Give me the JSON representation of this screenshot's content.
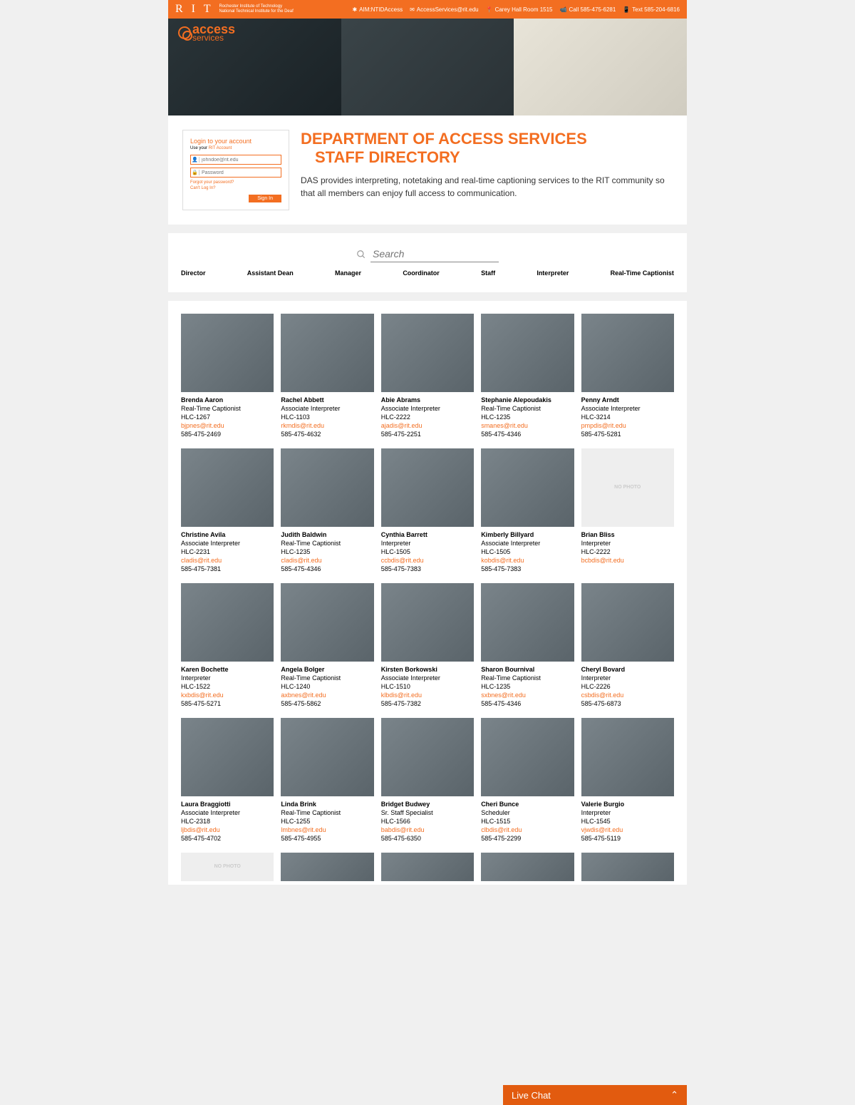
{
  "topbar": {
    "rit": "R I T",
    "sub1": "Rochester Institute of Technology",
    "sub2": "National Technical Institute for the Deaf",
    "items": [
      {
        "icon": "aim",
        "text": "AIM:NTIDAccess"
      },
      {
        "icon": "mail",
        "text": "AccessServices@rit.edu"
      },
      {
        "icon": "pin",
        "text": "Carey Hall Room 1515"
      },
      {
        "icon": "cam",
        "text": "Call 585-475-6281"
      },
      {
        "icon": "phone",
        "text": "Text 585-204-6816"
      }
    ]
  },
  "hero": {
    "brand1": "access",
    "brand2": "services"
  },
  "login": {
    "title": "Login to your account",
    "sub": "Use your ",
    "sub_link": "RIT Account",
    "ph_user": "johndoe@rit.edu",
    "ph_pass": "Password",
    "forgot": "Forgot your password?",
    "cant": "Can't Log In?",
    "btn": "Sign In"
  },
  "dept": {
    "t1": "DEPARTMENT OF ACCESS SERVICES",
    "t2": "STAFF DIRECTORY",
    "desc": "DAS provides interpreting, notetaking and real-time captioning services to the RIT community so that all members can enjoy full access to communication."
  },
  "search": {
    "placeholder": "Search"
  },
  "filters": [
    "Director",
    "Assistant Dean",
    "Manager",
    "Coordinator",
    "Staff",
    "Interpreter",
    "Real-Time Captionist"
  ],
  "nophoto": "NO PHOTO",
  "staff": [
    {
      "name": "Brenda Aaron",
      "role": "Real-Time Captionist",
      "room": "HLC-1267",
      "email": "bjpnes@rit.edu",
      "phone": "585-475-2469"
    },
    {
      "name": "Rachel Abbett",
      "role": "Associate Interpreter",
      "room": "HLC-1103",
      "email": "rkmdis@rit.edu",
      "phone": "585-475-4632"
    },
    {
      "name": "Abie Abrams",
      "role": "Associate Interpreter",
      "room": "HLC-2222",
      "email": "ajadis@rit.edu",
      "phone": "585-475-2251"
    },
    {
      "name": "Stephanie Alepoudakis",
      "role": "Real-Time Captionist",
      "room": "HLC-1235",
      "email": "smanes@rit.edu",
      "phone": "585-475-4346"
    },
    {
      "name": "Penny Arndt",
      "role": "Associate Interpreter",
      "room": "HLC-3214",
      "email": "pmpdis@rit.edu",
      "phone": "585-475-5281"
    },
    {
      "name": "Christine Avila",
      "role": "Associate Interpreter",
      "room": "HLC-2231",
      "email": "cladis@rit.edu",
      "phone": "585-475-7381"
    },
    {
      "name": "Judith Baldwin",
      "role": "Real-Time Captionist",
      "room": "HLC-1235",
      "email": "cladis@rit.edu",
      "phone": "585-475-4346"
    },
    {
      "name": "Cynthia Barrett",
      "role": "Interpreter",
      "room": "HLC-1505",
      "email": "ccbdis@rit.edu",
      "phone": "585-475-7383"
    },
    {
      "name": "Kimberly Billyard",
      "role": "Associate Interpreter",
      "room": "HLC-1505",
      "email": "kobdis@rit.edu",
      "phone": "585-475-7383"
    },
    {
      "name": "Brian Bliss",
      "role": "Interpreter",
      "room": "HLC-2222",
      "email": "bcbdis@rit.edu",
      "phone": "",
      "noph": true
    },
    {
      "name": "Karen Bochette",
      "role": "Interpreter",
      "room": "HLC-1522",
      "email": "kxbdis@rit.edu",
      "phone": "585-475-5271"
    },
    {
      "name": "Angela Bolger",
      "role": "Real-Time Captionist",
      "room": "HLC-1240",
      "email": "axbnes@rit.edu",
      "phone": "585-475-5862"
    },
    {
      "name": "Kirsten Borkowski",
      "role": "Associate Interpreter",
      "room": "HLC-1510",
      "email": "klbdis@rit.edu",
      "phone": "585-475-7382"
    },
    {
      "name": "Sharon Bournival",
      "role": "Real-Time Captionist",
      "room": "HLC-1235",
      "email": "sxbnes@rit.edu",
      "phone": "585-475-4346"
    },
    {
      "name": "Cheryl Bovard",
      "role": "Interpreter",
      "room": "HLC-2226",
      "email": "csbdis@rit.edu",
      "phone": "585-475-6873"
    },
    {
      "name": "Laura Braggiotti",
      "role": "Associate Interpreter",
      "room": "HLC-2318",
      "email": "ljbdis@rit.edu",
      "phone": "585-475-4702"
    },
    {
      "name": "Linda Brink",
      "role": "Real-Time Captionist",
      "room": "HLC-1255",
      "email": "lmbnes@rit.edu",
      "phone": "585-475-4955"
    },
    {
      "name": "Bridget Budwey",
      "role": "Sr. Staff Specialist",
      "room": "HLC-1566",
      "email": "babdis@rit.edu",
      "phone": "585-475-6350"
    },
    {
      "name": "Cheri Bunce",
      "role": "Scheduler",
      "room": "HLC-1515",
      "email": "clbdis@rit.edu",
      "phone": "585-475-2299"
    },
    {
      "name": "Valerie Burgio",
      "role": "Interpreter",
      "room": "HLC-1545",
      "email": "vjwdis@rit.edu",
      "phone": "585-475-5119"
    },
    {
      "name": "",
      "role": "",
      "room": "",
      "email": "",
      "phone": "",
      "noph": true,
      "partial": true
    },
    {
      "name": "",
      "role": "",
      "room": "",
      "email": "",
      "phone": "",
      "partial": true
    },
    {
      "name": "",
      "role": "",
      "room": "",
      "email": "",
      "phone": "",
      "partial": true
    },
    {
      "name": "",
      "role": "",
      "room": "",
      "email": "",
      "phone": "",
      "partial": true
    },
    {
      "name": "",
      "role": "",
      "room": "",
      "email": "",
      "phone": "",
      "partial": true
    }
  ],
  "chat": {
    "label": "Live Chat"
  }
}
